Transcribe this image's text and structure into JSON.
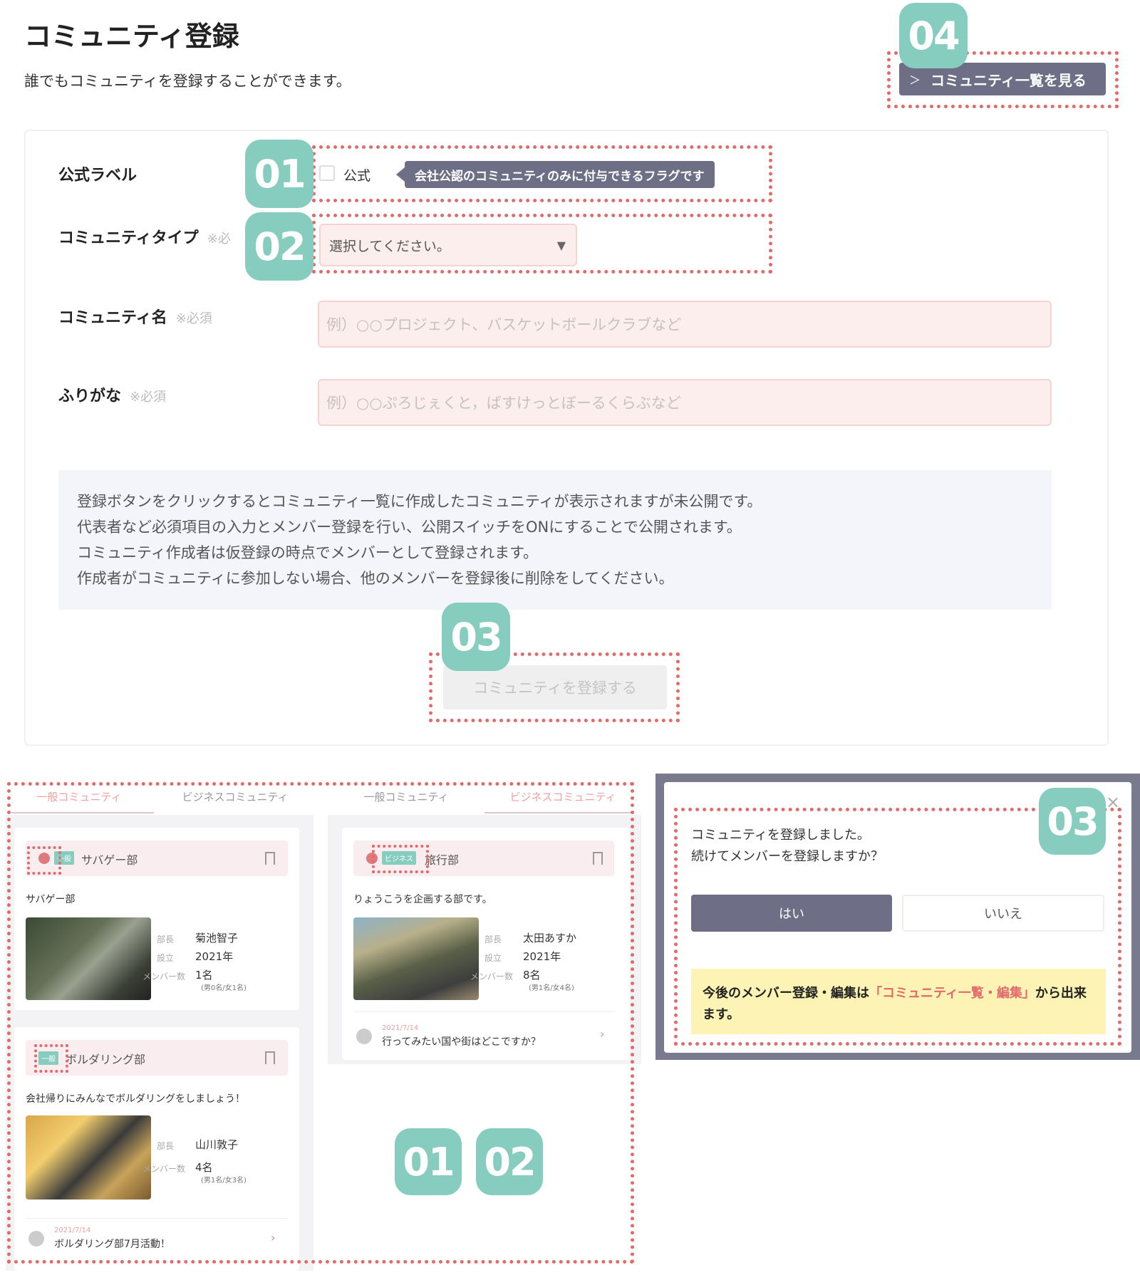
{
  "page": {
    "title": "コミュニティ登録",
    "subtitle": "誰でもコミュニティを登録することができます。",
    "list_button": "コミュニティ一覧を見る",
    "list_button_chevron": "＞"
  },
  "form": {
    "official": {
      "label": "公式ラベル",
      "checkbox_label": "公式",
      "tooltip": "会社公認のコミュニティのみに付与できるフラグです"
    },
    "type": {
      "label": "コミュニティタイプ",
      "required": "※必",
      "selected": "選択してください。",
      "arrow": "▼"
    },
    "name": {
      "label": "コミュニティ名",
      "required": "※必須",
      "placeholder": "例）○○プロジェクト、バスケットボールクラブなど"
    },
    "furigana": {
      "label": "ふりがな",
      "required": "※必須",
      "placeholder": "例）○○ぷろじぇくと，ばすけっとぼーるくらぶなど"
    },
    "notice": [
      "登録ボタンをクリックするとコミュニティ一覧に作成したコミュニティが表示されますが未公開です。",
      "代表者など必須項目の入力とメンバー登録を行い、公開スイッチをONにすることで公開されます。",
      "コミュニティ作成者は仮登録の時点でメンバーとして登録されます。",
      "作成者がコミュニティに参加しない場合、他のメンバーを登録後に削除をしてください。"
    ],
    "submit": "コミュニティを登録する"
  },
  "badges": {
    "b01": "01",
    "b02": "02",
    "b03": "03",
    "b04": "04"
  },
  "left_panel": {
    "tabs": [
      "一般コミュニティ",
      "ビジネスコミュニティ"
    ],
    "cards": [
      {
        "tag": "一般",
        "name": "サバゲー部",
        "desc": "サバゲー部",
        "leader_label": "部長",
        "leader": "菊池智子",
        "founded_label": "設立",
        "founded": "2021年",
        "members_label": "メンバー数",
        "members": "1名",
        "members_detail": "(男0名/女1名)"
      },
      {
        "tag": "一般",
        "name": "ボルダリング部",
        "desc": "会社帰りにみんなでボルダリングをしましょう！",
        "leader_label": "部長",
        "leader": "山川敦子",
        "members_label": "メンバー数",
        "members": "4名",
        "members_detail": "(男1名/女3名)",
        "post_date": "2021/7/14",
        "post_title": "ボルダリング部7月活動！"
      }
    ]
  },
  "mid_panel": {
    "tabs": [
      "一般コミュニティ",
      "ビジネスコミュニティ"
    ],
    "card": {
      "tag": "ビジネス",
      "name": "旅行部",
      "desc": "りょうこうを企画する部です。",
      "leader_label": "部長",
      "leader": "太田あすか",
      "founded_label": "設立",
      "founded": "2021年",
      "members_label": "メンバー数",
      "members": "8名",
      "members_detail": "(男1名/女4名)",
      "post_date": "2021/7/14",
      "post_title": "行ってみたい国や街はどこですか？"
    }
  },
  "dialog": {
    "line1": "コミュニティを登録しました。",
    "line2": "続けてメンバーを登録しますか？",
    "yes": "はい",
    "no": "いいえ",
    "note_pre": "今後のメンバー登録・編集は",
    "note_link": "「コミュニティ一覧・編集」",
    "note_post": "から出来ます。",
    "close": "×"
  },
  "colors": {
    "badge": "#86cdbf",
    "dash": "#e26a6a",
    "button_dark": "#6e6e86",
    "field_bg": "#fdeeee",
    "note_bg": "#fdf3b5"
  }
}
